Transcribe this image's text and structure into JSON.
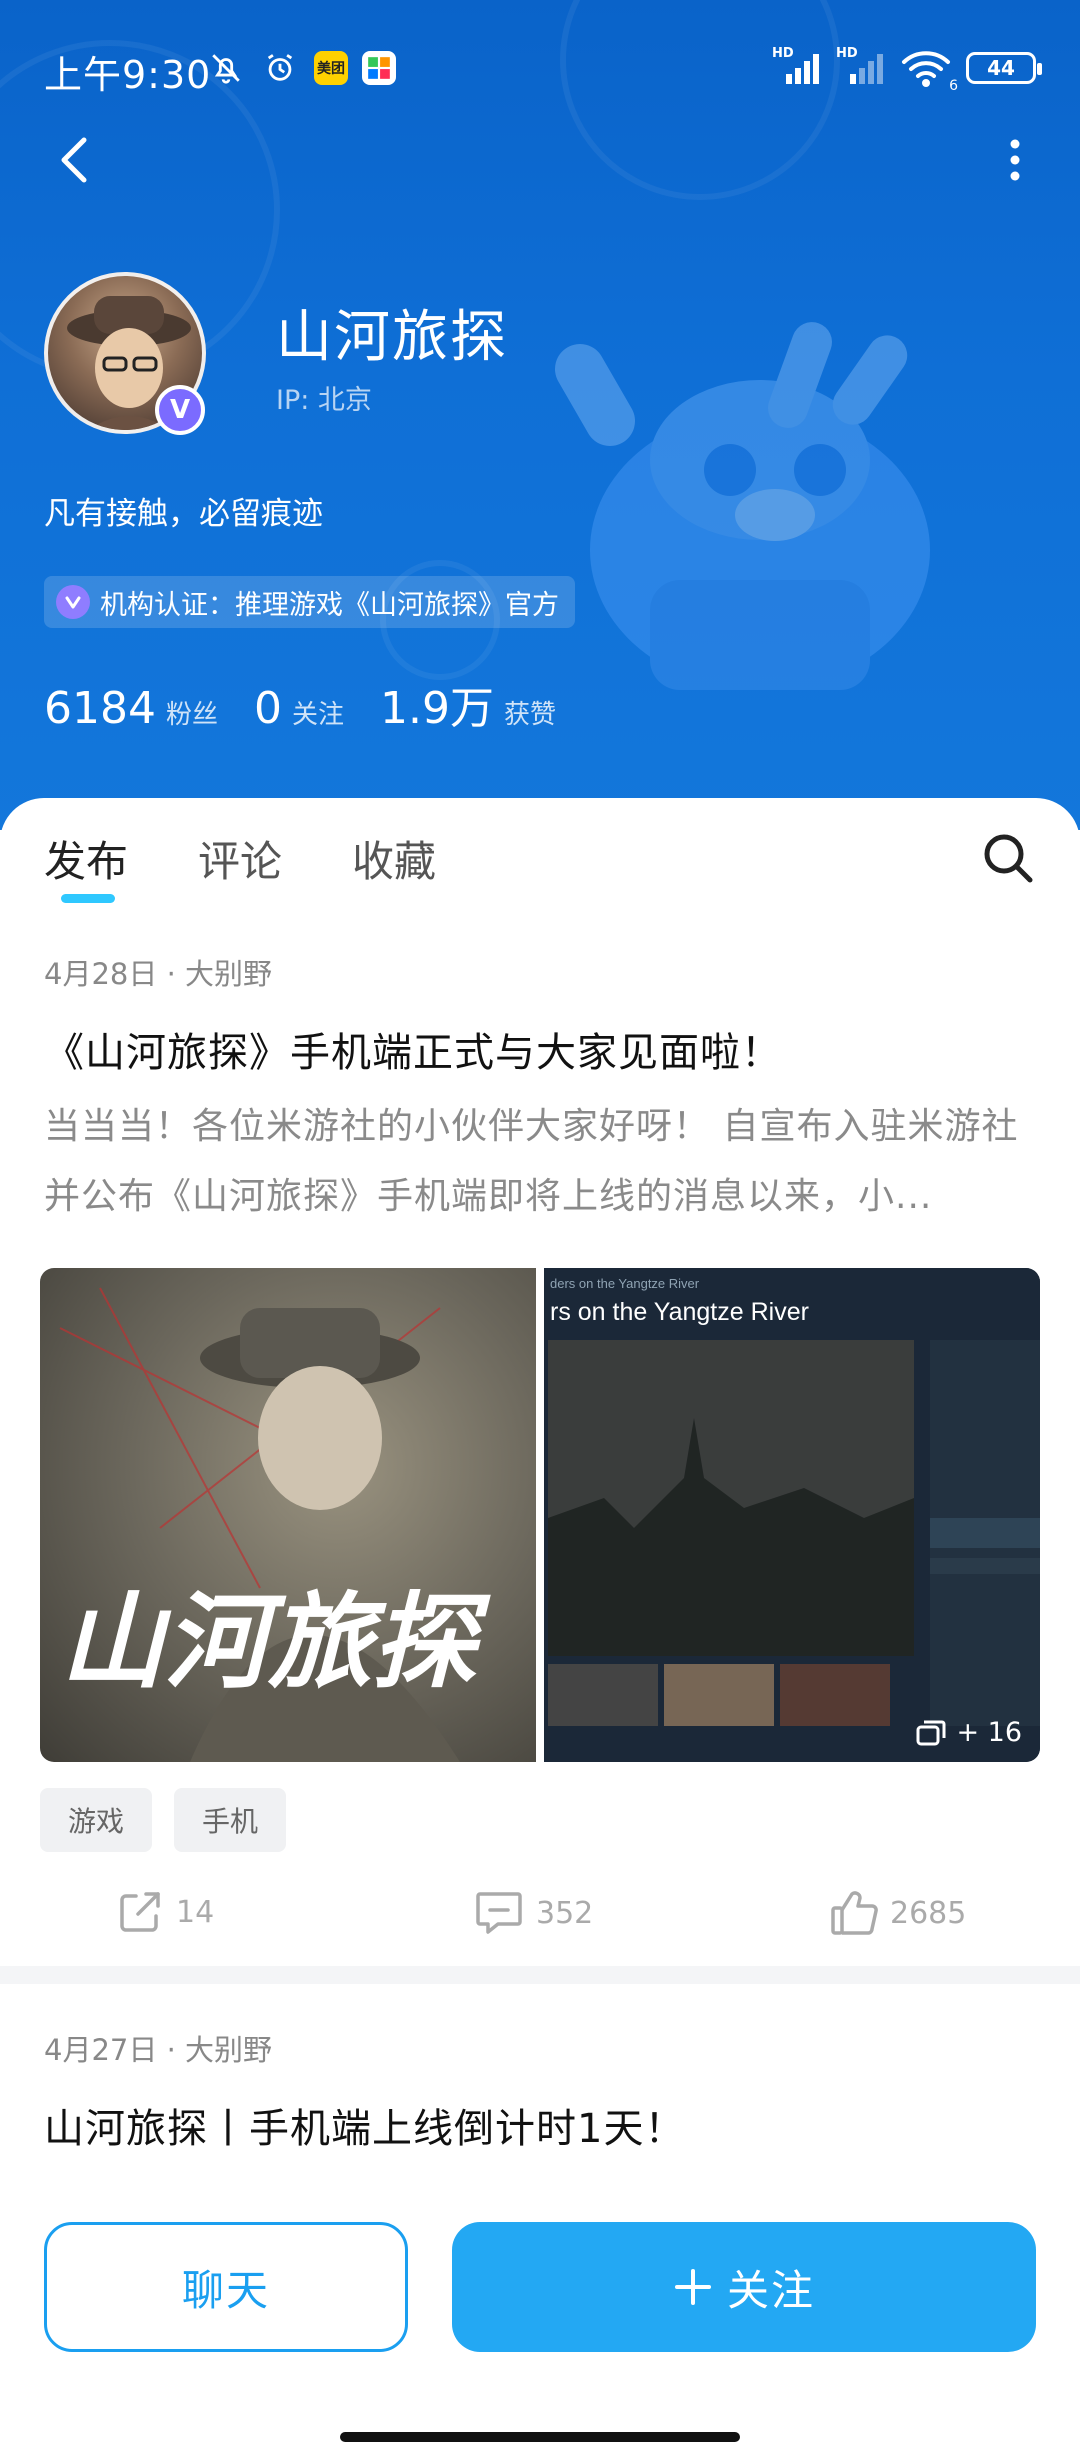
{
  "status_bar": {
    "time": "上午9:30",
    "app_badge_meituan": "美团",
    "battery": "44",
    "signal_label_1": "HD",
    "signal_label_2": "HD",
    "wifi_sub": "6"
  },
  "profile": {
    "name": "山河旅探",
    "ip": "IP: 北京",
    "bio": "凡有接触，必留痕迹",
    "certification": "机构认证：推理游戏《山河旅探》官方",
    "verify_badge": "V",
    "stats": [
      {
        "value": "6184",
        "label": "粉丝"
      },
      {
        "value": "0",
        "label": "关注"
      },
      {
        "value": "1.9万",
        "label": "获赞"
      }
    ]
  },
  "tabs": [
    {
      "label": "发布",
      "active": true
    },
    {
      "label": "评论",
      "active": false
    },
    {
      "label": "收藏",
      "active": false
    }
  ],
  "posts": [
    {
      "meta": "4月28日 · 大别野",
      "title": "《山河旅探》手机端正式与大家见面啦！",
      "excerpt": "当当当！各位米游社的小伙伴大家好呀！ 自宣布入驻米游社并公布《山河旅探》手机端即将上线的消息以来，小...",
      "image1_caption": "山河旅探",
      "image2_caption": "rs on the Yangtze River",
      "image2_header": "ders on the Yangtze River",
      "more_images": "+ 16",
      "tags": [
        "游戏",
        "手机"
      ],
      "shares": "14",
      "comments": "352",
      "likes": "2685"
    },
    {
      "meta": "4月27日 · 大别野",
      "title": "山河旅探丨手机端上线倒计时1天！"
    }
  ],
  "bottom": {
    "chat_label": "聊天",
    "follow_label": "关注",
    "follow_icon": "plus-icon"
  },
  "colors": {
    "header_blue": "#0f6fd6",
    "accent": "#23a8f3",
    "tab_underline": "#2fc8ff",
    "verify_purple": "#7b6bff"
  }
}
